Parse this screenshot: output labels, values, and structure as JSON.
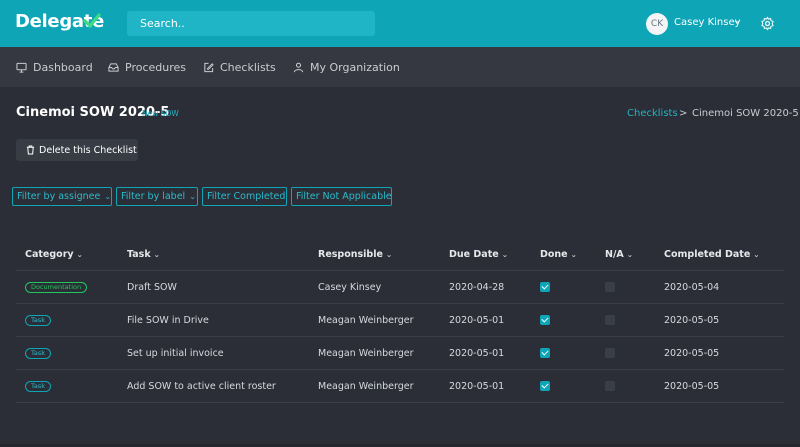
{
  "app": {
    "logo_text": "Delegate"
  },
  "search": {
    "placeholder": "Search.."
  },
  "user": {
    "initials": "CK",
    "name": "Casey Kinsey"
  },
  "nav": [
    {
      "label": "Dashboard",
      "icon": "monitor-icon"
    },
    {
      "label": "Procedures",
      "icon": "inbox-icon"
    },
    {
      "label": "Checklists",
      "icon": "edit-icon"
    },
    {
      "label": "My Organization",
      "icon": "user-icon"
    }
  ],
  "page": {
    "title": "Cinemoi SOW 2020-5",
    "subtitle": "New SOW",
    "breadcrumb": {
      "parent": "Checklists",
      "separator": ">",
      "current": "Cinemoi SOW 2020-5"
    },
    "delete_label": "Delete this Checklist"
  },
  "filters": [
    {
      "label": "Filter by assignee",
      "dropdown": true
    },
    {
      "label": "Filter by label",
      "dropdown": true
    },
    {
      "label": "Filter Completed",
      "dropdown": false
    },
    {
      "label": "Filter Not Applicable",
      "dropdown": false
    }
  ],
  "table": {
    "columns": [
      "Category",
      "Task",
      "Responsible",
      "Due Date",
      "Done",
      "N/A",
      "Completed Date"
    ],
    "rows": [
      {
        "category": "Documentation",
        "task": "Draft SOW",
        "responsible": "Casey Kinsey",
        "due": "2020-04-28",
        "done": true,
        "na": false,
        "completed": "2020-05-04"
      },
      {
        "category": "Task",
        "task": "File SOW in Drive",
        "responsible": "Meagan Weinberger",
        "due": "2020-05-01",
        "done": true,
        "na": false,
        "completed": "2020-05-05"
      },
      {
        "category": "Task",
        "task": "Set up initial invoice",
        "responsible": "Meagan Weinberger",
        "due": "2020-05-01",
        "done": true,
        "na": false,
        "completed": "2020-05-05"
      },
      {
        "category": "Task",
        "task": "Add SOW to active client roster",
        "responsible": "Meagan Weinberger",
        "due": "2020-05-01",
        "done": true,
        "na": false,
        "completed": "2020-05-05"
      }
    ]
  },
  "colors": {
    "accent": "#0ea5b7",
    "documentation": "#22c55e",
    "background": "#2b2e36"
  }
}
